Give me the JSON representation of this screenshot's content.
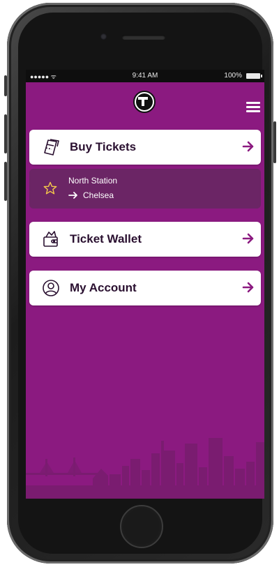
{
  "status_bar": {
    "signal": "●●●●● ᯤ",
    "time": "9:41 AM",
    "battery": "100%"
  },
  "header": {
    "logo_letter": "T",
    "menu_icon": "hamburger-menu-icon"
  },
  "menu": {
    "buy_tickets": {
      "label": "Buy Tickets",
      "icon": "ticket-icon"
    },
    "favorite_trip": {
      "from": "North Station",
      "to": "Chelsea",
      "icon": "star-icon"
    },
    "ticket_wallet": {
      "label": "Ticket Wallet",
      "icon": "wallet-icon"
    },
    "my_account": {
      "label": "My Account",
      "icon": "user-icon"
    }
  },
  "colors": {
    "background": "#8b1a80",
    "favorite_row": "#6b2565",
    "arrow": "#8b1a80",
    "star": "#f5c84a"
  }
}
